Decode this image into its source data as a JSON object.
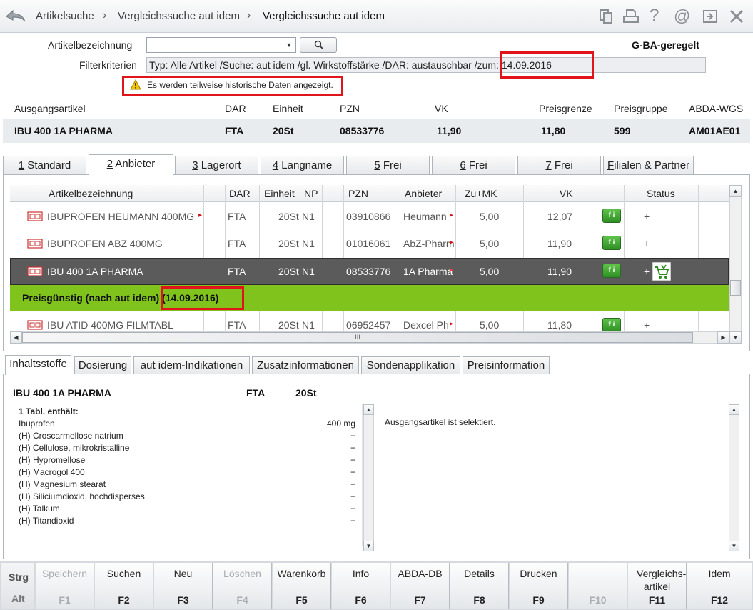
{
  "breadcrumb": [
    "Artikelsuche",
    "Vergleichssuche aut idem",
    "Vergleichssuche aut idem"
  ],
  "icons": [
    "back-arrow-icon",
    "copy-icon",
    "print-icon",
    "help-icon",
    "email-icon",
    "window-icon",
    "close-icon"
  ],
  "search": {
    "label_article": "Artikelbezeichnung",
    "label_filter": "Filterkriterien",
    "article_value": "",
    "filter_value": "Typ: Alle Artikel /Suche: aut idem /gl. Wirkstoffstärke /DAR: austauschbar /zum: 14.09.2016",
    "gba": "G-BA-geregelt",
    "warning": "Es werden teilweise historische Daten angezeigt."
  },
  "origin": {
    "headers": [
      "Ausgangsartikel",
      "DAR",
      "Einheit",
      "PZN",
      "VK",
      "Preisgrenze",
      "Preisgruppe",
      "ABDA-WGS"
    ],
    "values": [
      "IBU 400 1A PHARMA",
      "FTA",
      "20St",
      "08533776",
      "11,90",
      "11,80",
      "599",
      "AM01AE01"
    ]
  },
  "tabs": [
    {
      "num": "1",
      "label": " Standard"
    },
    {
      "num": "2",
      "label": " Anbieter"
    },
    {
      "num": "3",
      "label": " Lagerort"
    },
    {
      "num": "4",
      "label": " Langname"
    },
    {
      "num": "5",
      "label": " Frei"
    },
    {
      "num": "6",
      "label": " Frei"
    },
    {
      "num": "7",
      "label": " Frei"
    },
    {
      "num": "F",
      "label": "ilialen & Partner"
    }
  ],
  "table": {
    "headers": [
      "Artikelbezeichnung",
      "DAR",
      "Einheit",
      "NP",
      "PZN",
      "Anbieter",
      "Zu+MK",
      "VK",
      "Status"
    ],
    "rows": [
      {
        "name": "IBUPROFEN HEUMANN 400MG",
        "dar": "FTA",
        "unit": "20St",
        "np": "N1",
        "pzn": "03910866",
        "vendor": "Heumann",
        "zumk": "5,00",
        "vk": "12,07",
        "status": "+"
      },
      {
        "name": "IBUPROFEN ABZ 400MG",
        "dar": "FTA",
        "unit": "20St",
        "np": "N1",
        "pzn": "01016061",
        "vendor": "AbZ-Pharm",
        "zumk": "5,00",
        "vk": "11,90",
        "status": "+"
      },
      {
        "name": "IBU 400 1A PHARMA",
        "dar": "FTA",
        "unit": "20St",
        "np": "N1",
        "pzn": "08533776",
        "vendor": "1A Pharma",
        "zumk": "5,00",
        "vk": "11,90",
        "status": "+"
      },
      {
        "name": "IBU ATID 400MG FILMTABL",
        "dar": "FTA",
        "unit": "20St",
        "np": "N1",
        "pzn": "06952457",
        "vendor": "Dexcel Ph",
        "zumk": "5,00",
        "vk": "11,80",
        "status": "+"
      }
    ],
    "group_label": "Preisgünstig (nach aut idem)",
    "group_date": "(14.09.2016)",
    "status_icon": "f i",
    "scroll_grip": "III"
  },
  "bottom_tabs": [
    "Inhaltsstoffe",
    "Dosierung",
    "aut idem-Indikationen",
    "Zusatzinformationen",
    "Sondenapplikation",
    "Preisinformation"
  ],
  "detail": {
    "name": "IBU 400 1A PHARMA",
    "dar": "FTA",
    "unit": "20St",
    "contains_label": "1 Tabl. enthält:",
    "ingredients": [
      {
        "name": "Ibuprofen",
        "value": "400 mg"
      },
      {
        "name": "(H) Croscarmellose natrium",
        "value": "+"
      },
      {
        "name": "(H) Cellulose, mikrokristalline",
        "value": "+"
      },
      {
        "name": "(H) Hypromellose",
        "value": "+"
      },
      {
        "name": "(H) Macrogol 400",
        "value": "+"
      },
      {
        "name": "(H) Magnesium stearat",
        "value": "+"
      },
      {
        "name": "(H) Siliciumdioxid, hochdisperses",
        "value": "+"
      },
      {
        "name": "(H) Talkum",
        "value": "+"
      },
      {
        "name": "(H) Titandioxid",
        "value": "+"
      }
    ],
    "info": "Ausgangsartikel ist selektiert."
  },
  "modifiers": [
    "Strg",
    "Alt"
  ],
  "fkeys": [
    {
      "label": "Speichern",
      "key": "F1",
      "enabled": false
    },
    {
      "label": "Suchen",
      "key": "F2",
      "enabled": true
    },
    {
      "label": "Neu",
      "key": "F3",
      "enabled": true
    },
    {
      "label": "Löschen",
      "key": "F4",
      "enabled": false
    },
    {
      "label": "Warenkorb",
      "key": "F5",
      "enabled": true
    },
    {
      "label": "Info",
      "key": "F6",
      "enabled": true
    },
    {
      "label": "ABDA-DB",
      "key": "F7",
      "enabled": true
    },
    {
      "label": "Details",
      "key": "F8",
      "enabled": true
    },
    {
      "label": "Drucken",
      "key": "F9",
      "enabled": true
    },
    {
      "label": "",
      "key": "F10",
      "enabled": false
    },
    {
      "label": "Vergleichs-artikel",
      "key": "F11",
      "enabled": true
    },
    {
      "label": "Idem",
      "key": "F12",
      "enabled": true
    }
  ],
  "colors": {
    "accent_green": "#7fc31c",
    "highlight_red": "#e0141a",
    "selected_row": "#5b5b5b"
  }
}
